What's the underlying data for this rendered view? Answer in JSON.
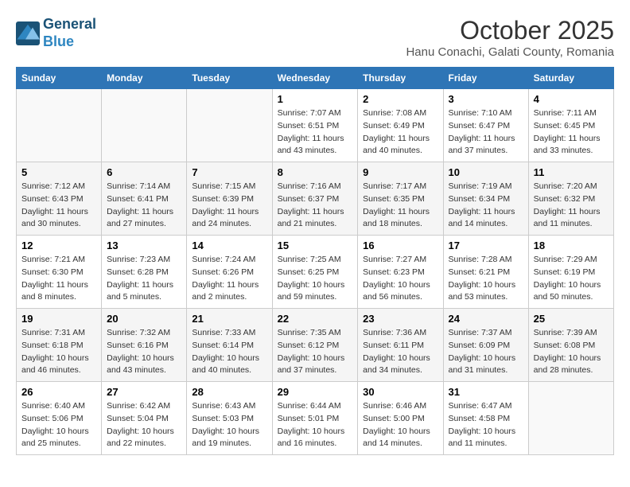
{
  "header": {
    "logo_line1": "General",
    "logo_line2": "Blue",
    "month": "October 2025",
    "location": "Hanu Conachi, Galati County, Romania"
  },
  "weekdays": [
    "Sunday",
    "Monday",
    "Tuesday",
    "Wednesday",
    "Thursday",
    "Friday",
    "Saturday"
  ],
  "weeks": [
    [
      {
        "day": "",
        "sunrise": "",
        "sunset": "",
        "daylight": ""
      },
      {
        "day": "",
        "sunrise": "",
        "sunset": "",
        "daylight": ""
      },
      {
        "day": "",
        "sunrise": "",
        "sunset": "",
        "daylight": ""
      },
      {
        "day": "1",
        "sunrise": "Sunrise: 7:07 AM",
        "sunset": "Sunset: 6:51 PM",
        "daylight": "Daylight: 11 hours and 43 minutes."
      },
      {
        "day": "2",
        "sunrise": "Sunrise: 7:08 AM",
        "sunset": "Sunset: 6:49 PM",
        "daylight": "Daylight: 11 hours and 40 minutes."
      },
      {
        "day": "3",
        "sunrise": "Sunrise: 7:10 AM",
        "sunset": "Sunset: 6:47 PM",
        "daylight": "Daylight: 11 hours and 37 minutes."
      },
      {
        "day": "4",
        "sunrise": "Sunrise: 7:11 AM",
        "sunset": "Sunset: 6:45 PM",
        "daylight": "Daylight: 11 hours and 33 minutes."
      }
    ],
    [
      {
        "day": "5",
        "sunrise": "Sunrise: 7:12 AM",
        "sunset": "Sunset: 6:43 PM",
        "daylight": "Daylight: 11 hours and 30 minutes."
      },
      {
        "day": "6",
        "sunrise": "Sunrise: 7:14 AM",
        "sunset": "Sunset: 6:41 PM",
        "daylight": "Daylight: 11 hours and 27 minutes."
      },
      {
        "day": "7",
        "sunrise": "Sunrise: 7:15 AM",
        "sunset": "Sunset: 6:39 PM",
        "daylight": "Daylight: 11 hours and 24 minutes."
      },
      {
        "day": "8",
        "sunrise": "Sunrise: 7:16 AM",
        "sunset": "Sunset: 6:37 PM",
        "daylight": "Daylight: 11 hours and 21 minutes."
      },
      {
        "day": "9",
        "sunrise": "Sunrise: 7:17 AM",
        "sunset": "Sunset: 6:35 PM",
        "daylight": "Daylight: 11 hours and 18 minutes."
      },
      {
        "day": "10",
        "sunrise": "Sunrise: 7:19 AM",
        "sunset": "Sunset: 6:34 PM",
        "daylight": "Daylight: 11 hours and 14 minutes."
      },
      {
        "day": "11",
        "sunrise": "Sunrise: 7:20 AM",
        "sunset": "Sunset: 6:32 PM",
        "daylight": "Daylight: 11 hours and 11 minutes."
      }
    ],
    [
      {
        "day": "12",
        "sunrise": "Sunrise: 7:21 AM",
        "sunset": "Sunset: 6:30 PM",
        "daylight": "Daylight: 11 hours and 8 minutes."
      },
      {
        "day": "13",
        "sunrise": "Sunrise: 7:23 AM",
        "sunset": "Sunset: 6:28 PM",
        "daylight": "Daylight: 11 hours and 5 minutes."
      },
      {
        "day": "14",
        "sunrise": "Sunrise: 7:24 AM",
        "sunset": "Sunset: 6:26 PM",
        "daylight": "Daylight: 11 hours and 2 minutes."
      },
      {
        "day": "15",
        "sunrise": "Sunrise: 7:25 AM",
        "sunset": "Sunset: 6:25 PM",
        "daylight": "Daylight: 10 hours and 59 minutes."
      },
      {
        "day": "16",
        "sunrise": "Sunrise: 7:27 AM",
        "sunset": "Sunset: 6:23 PM",
        "daylight": "Daylight: 10 hours and 56 minutes."
      },
      {
        "day": "17",
        "sunrise": "Sunrise: 7:28 AM",
        "sunset": "Sunset: 6:21 PM",
        "daylight": "Daylight: 10 hours and 53 minutes."
      },
      {
        "day": "18",
        "sunrise": "Sunrise: 7:29 AM",
        "sunset": "Sunset: 6:19 PM",
        "daylight": "Daylight: 10 hours and 50 minutes."
      }
    ],
    [
      {
        "day": "19",
        "sunrise": "Sunrise: 7:31 AM",
        "sunset": "Sunset: 6:18 PM",
        "daylight": "Daylight: 10 hours and 46 minutes."
      },
      {
        "day": "20",
        "sunrise": "Sunrise: 7:32 AM",
        "sunset": "Sunset: 6:16 PM",
        "daylight": "Daylight: 10 hours and 43 minutes."
      },
      {
        "day": "21",
        "sunrise": "Sunrise: 7:33 AM",
        "sunset": "Sunset: 6:14 PM",
        "daylight": "Daylight: 10 hours and 40 minutes."
      },
      {
        "day": "22",
        "sunrise": "Sunrise: 7:35 AM",
        "sunset": "Sunset: 6:12 PM",
        "daylight": "Daylight: 10 hours and 37 minutes."
      },
      {
        "day": "23",
        "sunrise": "Sunrise: 7:36 AM",
        "sunset": "Sunset: 6:11 PM",
        "daylight": "Daylight: 10 hours and 34 minutes."
      },
      {
        "day": "24",
        "sunrise": "Sunrise: 7:37 AM",
        "sunset": "Sunset: 6:09 PM",
        "daylight": "Daylight: 10 hours and 31 minutes."
      },
      {
        "day": "25",
        "sunrise": "Sunrise: 7:39 AM",
        "sunset": "Sunset: 6:08 PM",
        "daylight": "Daylight: 10 hours and 28 minutes."
      }
    ],
    [
      {
        "day": "26",
        "sunrise": "Sunrise: 6:40 AM",
        "sunset": "Sunset: 5:06 PM",
        "daylight": "Daylight: 10 hours and 25 minutes."
      },
      {
        "day": "27",
        "sunrise": "Sunrise: 6:42 AM",
        "sunset": "Sunset: 5:04 PM",
        "daylight": "Daylight: 10 hours and 22 minutes."
      },
      {
        "day": "28",
        "sunrise": "Sunrise: 6:43 AM",
        "sunset": "Sunset: 5:03 PM",
        "daylight": "Daylight: 10 hours and 19 minutes."
      },
      {
        "day": "29",
        "sunrise": "Sunrise: 6:44 AM",
        "sunset": "Sunset: 5:01 PM",
        "daylight": "Daylight: 10 hours and 16 minutes."
      },
      {
        "day": "30",
        "sunrise": "Sunrise: 6:46 AM",
        "sunset": "Sunset: 5:00 PM",
        "daylight": "Daylight: 10 hours and 14 minutes."
      },
      {
        "day": "31",
        "sunrise": "Sunrise: 6:47 AM",
        "sunset": "Sunset: 4:58 PM",
        "daylight": "Daylight: 10 hours and 11 minutes."
      },
      {
        "day": "",
        "sunrise": "",
        "sunset": "",
        "daylight": ""
      }
    ]
  ]
}
